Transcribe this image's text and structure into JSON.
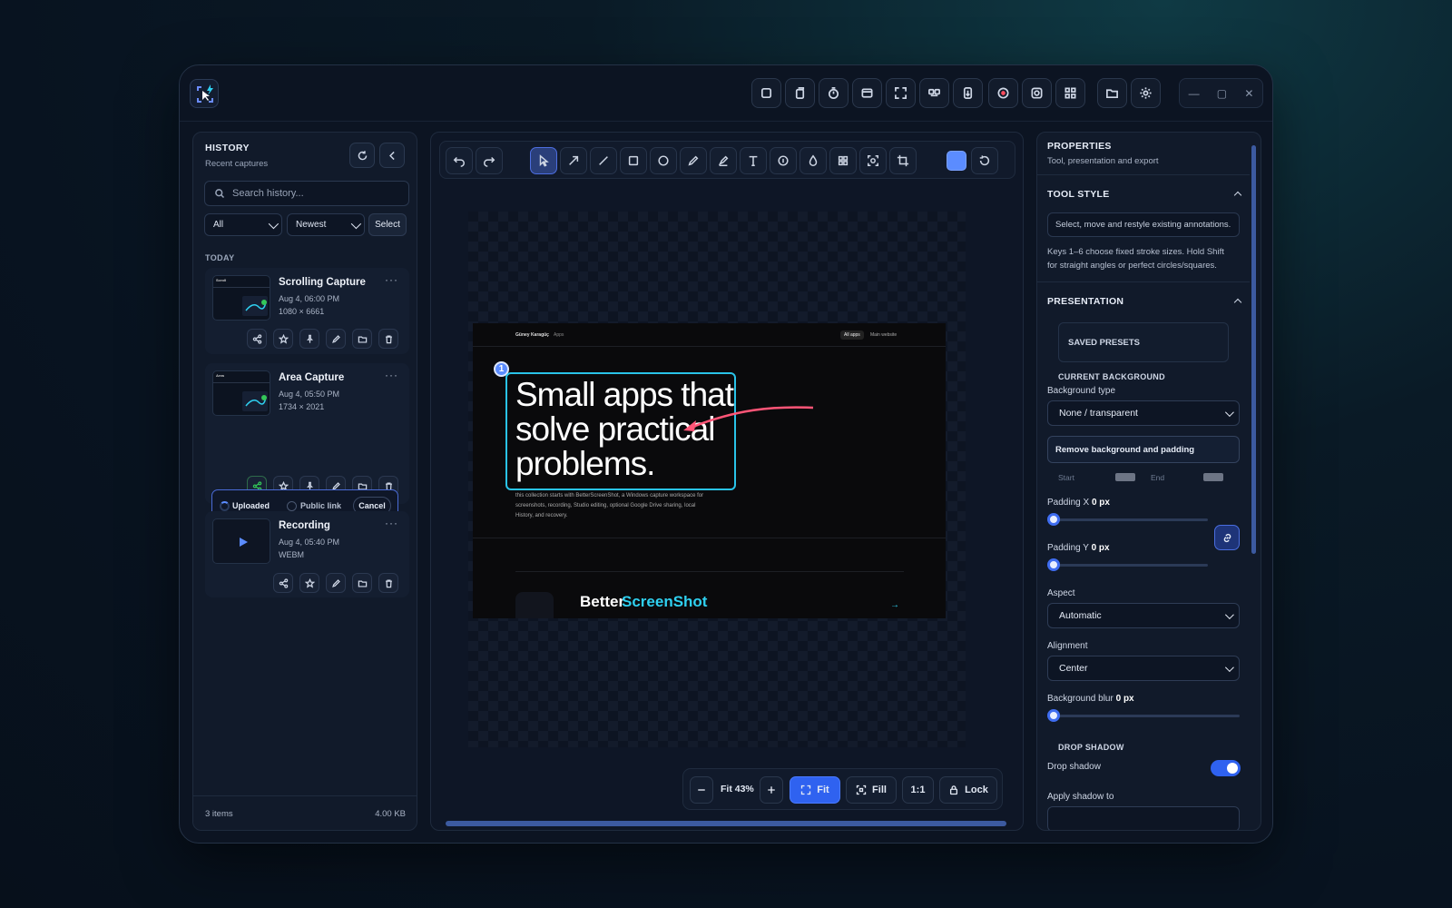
{
  "app": {
    "name": "BetterScreenShot"
  },
  "window_controls": {
    "minimize": "—",
    "maximize": "▢",
    "close": "✕"
  },
  "history": {
    "title": "HISTORY",
    "subtitle": "Recent captures",
    "search_placeholder": "Search history...",
    "filter_type": "All",
    "sort": "Newest",
    "select_label": "Select",
    "group_label": "TODAY",
    "items": [
      {
        "title": "Scrolling Capture",
        "date": "Aug 4, 06:00 PM",
        "meta": "1080 × 6661",
        "thumb_label": "Scroll"
      },
      {
        "title": "Area Capture",
        "date": "Aug 4, 05:50 PM",
        "meta": "1734 × 2021",
        "thumb_label": "Area"
      },
      {
        "title": "Recording",
        "date": "Aug 4, 05:40 PM",
        "meta": "WEBM"
      }
    ],
    "upload": {
      "status": "Uploaded",
      "public_link": "Public link",
      "cancel": "Cancel",
      "progress": 0.62
    },
    "footer_count": "3 items",
    "footer_size": "4.00 KB"
  },
  "canvas": {
    "shot": {
      "brand": "Güney Karagüç",
      "brand_sub": "Apps",
      "nav_all": "All apps",
      "nav_main": "Main website",
      "headline_1": "Small apps that",
      "headline_2": "solve practical",
      "headline_3": "problems.",
      "badge": "1",
      "body_1": "this collection starts with BetterScreenShot, a Windows capture workspace for",
      "body_2": "screenshots, recording, Studio editing, optional Google Drive sharing, local",
      "body_3": "History, and recovery.",
      "product_a": "Better",
      "product_b": "ScreenShot",
      "arrow": "→"
    },
    "zoom": {
      "label": "Fit 43%",
      "fit": "Fit",
      "fill": "Fill",
      "one": "1:1",
      "lock": "Lock"
    },
    "accent": "#5b8cff"
  },
  "properties": {
    "title": "PROPERTIES",
    "subtitle": "Tool, presentation and export",
    "tool_style": {
      "heading": "TOOL STYLE",
      "hint": "Select, move and restyle existing annotations.",
      "help_1": "Keys 1–6 choose fixed stroke sizes. Hold Shift",
      "help_2": "for straight angles or perfect circles/squares."
    },
    "presentation": {
      "heading": "PRESENTATION",
      "saved_presets": "SAVED PRESETS",
      "current_background": "CURRENT BACKGROUND",
      "background_type_label": "Background type",
      "background_type": "None / transparent",
      "remove_bg": "Remove background and padding",
      "start": "Start",
      "end": "End",
      "padding_x_label": "Padding X",
      "padding_x": "0 px",
      "padding_y_label": "Padding Y",
      "padding_y": "0 px",
      "aspect_label": "Aspect",
      "aspect": "Automatic",
      "alignment_label": "Alignment",
      "alignment": "Center",
      "blur_label": "Background blur",
      "blur": "0 px",
      "drop_shadow_heading": "DROP SHADOW",
      "drop_shadow_label": "Drop shadow",
      "drop_shadow_on": true,
      "apply_shadow_label": "Apply shadow to"
    }
  }
}
